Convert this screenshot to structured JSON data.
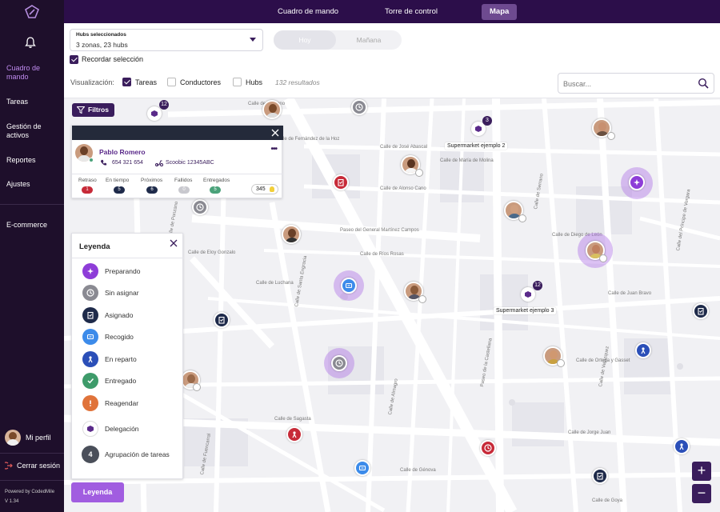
{
  "sidebar": {
    "items": [
      {
        "label": "Cuadro de mando"
      },
      {
        "label": "Tareas"
      },
      {
        "label": "Gestión de activos"
      },
      {
        "label": "Reportes"
      },
      {
        "label": "Ajustes"
      },
      {
        "label": "E-commerce"
      }
    ],
    "profile_label": "Mi perfil",
    "logout_label": "Cerrar sesión",
    "powered_by": "Powered by CodedMile",
    "version": "V 1.34"
  },
  "topbar": {
    "tabs": [
      {
        "label": "Cuadro de mando"
      },
      {
        "label": "Torre de control"
      },
      {
        "label": "Mapa"
      }
    ]
  },
  "controls": {
    "hubs_label": "Hubs seleccionados",
    "hubs_value": "3 zonas, 23 hubs",
    "day_today": "Hoy",
    "day_tomorrow": "Mañana",
    "remember_label": "Recordar selección",
    "visualization_label": "Visualización:",
    "tasks_label": "Tareas",
    "drivers_label": "Conductores",
    "hubs_check_label": "Hubs",
    "results": "132 resultados",
    "search_placeholder": "Buscar..."
  },
  "map": {
    "filters_label": "Filtros",
    "supermarket_2": "Supermarket ejemplo 2",
    "supermarket_3": "Supermarket ejemplo 3",
    "cluster_count_a": "12",
    "cluster_count_b": "3",
    "cluster_count_c": "12",
    "streets": [
      "Calle de Zurbano",
      "Paseo del General Martínez Campos",
      "Calle de José Abascal",
      "Calle de Fernández de la Hoz",
      "Calle de Santa Engracia",
      "Calle de Ríos Rosas",
      "Calle de Ponzano",
      "Calle de Serrano",
      "Calle del Príncipe de Vergara",
      "Calle de Juan Bravo",
      "Paseo de la Castellana",
      "Calle de Eloy Gonzalo",
      "Calle de Sagasta",
      "Calle de Génova",
      "Calle de María de Molina",
      "Calle de Almagro",
      "Calle de Alonso Cano",
      "Calle de Velázquez",
      "Calle de Goya",
      "Calle de Diego de León",
      "Calle de Ortega y Gasset",
      "Calle de Jorge Juan",
      "Calle de Fuencarral",
      "Calle de Luchana"
    ]
  },
  "driver_card": {
    "name": "Pablo Romero",
    "phone": "654 321 654",
    "vehicle": "Scoobic 12345ABC",
    "stats": [
      {
        "label": "Retraso",
        "value": "1",
        "color": "#c72a38"
      },
      {
        "label": "En tiempo",
        "value": "5",
        "color": "#1e2a4a"
      },
      {
        "label": "Próximos",
        "value": "6",
        "color": "#1e2a4a"
      },
      {
        "label": "Fallidos",
        "value": "0",
        "color": "#c8c8ce"
      },
      {
        "label": "Entregados",
        "value": "5",
        "color": "#4aa27a"
      }
    ],
    "points": "345"
  },
  "legend": {
    "title": "Leyenda",
    "items": [
      {
        "label": "Preparando",
        "icon": "sparkle-icon",
        "color": "#8e3dd8"
      },
      {
        "label": "Sin asignar",
        "icon": "clock-icon",
        "color": "#8a8a92"
      },
      {
        "label": "Asignado",
        "icon": "clipboard-icon",
        "color": "#1e2a4a"
      },
      {
        "label": "Recogido",
        "icon": "package-icon",
        "color": "#3c8bea"
      },
      {
        "label": "En reparto",
        "icon": "delivery-icon",
        "color": "#2b4fb8"
      },
      {
        "label": "Entregado",
        "icon": "check-icon",
        "color": "#3e9b6a"
      },
      {
        "label": "Reagendar",
        "icon": "exclamation-icon",
        "color": "#e0733a"
      },
      {
        "label": "Delegación",
        "icon": "cube-icon",
        "color": "#5a2a8a"
      },
      {
        "label": "Agrupación de tareas",
        "icon": "cluster-icon",
        "color": "#4a4f5a"
      }
    ],
    "cluster_number": "4",
    "button_label": "Leyenda"
  },
  "zoom": {
    "in": "+",
    "out": "−"
  }
}
